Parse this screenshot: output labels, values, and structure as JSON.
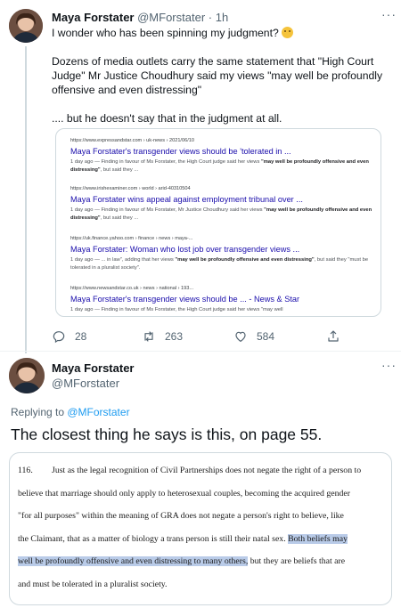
{
  "tweet1": {
    "name": "Maya Forstater",
    "handle": "@MForstater",
    "time": "1h",
    "line1": "I wonder who has been spinning my judgment?",
    "para2": "Dozens of media outlets carry the same statement that \"High Court Judge\" Mr Justice Choudhury said my views \"may well be profoundly offensive and even distressing\"",
    "para3": ".... but he doesn't say that in the judgment at all.",
    "results": [
      {
        "url": "https://www.expressandstar.com › uk-news › 2021/06/10",
        "title": "Maya Forstater's transgender views should be 'tolerated in ...",
        "snippet_plain": "1 day ago — Finding in favour of Ms Forstater, the High Court judge said her views ",
        "snippet_bold": "\"may well be profoundly offensive and even distressing\"",
        "snippet_tail": ", but said they ..."
      },
      {
        "url": "https://www.irishexaminer.com › world › arid-40310504",
        "title": "Maya Forstater wins appeal against employment tribunal over ...",
        "snippet_plain": "1 day ago — Finding in favour of Ms Forstater, Mr Justice Choudhury said her views ",
        "snippet_bold": "\"may well be profoundly offensive and even distressing\"",
        "snippet_tail": ", but said they ..."
      },
      {
        "url": "https://uk.finance.yahoo.com › finance › news › maya-...",
        "title": "Maya Forstater: Woman who lost job over transgender views ...",
        "snippet_plain": "1 day ago — ... in law\", adding that her views ",
        "snippet_bold": "\"may well be profoundly offensive and even distressing\"",
        "snippet_tail": ", but said they \"must be tolerated in a pluralist society\"."
      },
      {
        "url": "https://www.newsandstar.co.uk › news › national › 193...",
        "title": "Maya Forstater's transgender views should be ... - News & Star",
        "snippet_plain": "1 day ago — Finding in favour of Ms Forstater, the High Court judge said her views \"may well",
        "snippet_bold": "",
        "snippet_tail": ""
      }
    ],
    "replies": "28",
    "retweets": "263",
    "likes": "584"
  },
  "tweet2": {
    "name": "Maya Forstater",
    "handle": "@MForstater",
    "replying_prefix": "Replying to ",
    "replying_to": "@MForstater",
    "text": "The closest thing he says is this, on page 55.",
    "doc": {
      "para_num": "116.",
      "line1": "Just as the legal recognition of Civil Partnerships does not negate the right of a person to",
      "line2": "believe that marriage should only apply to heterosexual couples, becoming the acquired gender",
      "line3": "\"for all purposes\" within the meaning of GRA does not negate a person's right to believe, like",
      "line4_plain": "the Claimant, that as a matter of biology a trans person is still their natal sex.  ",
      "line4_hl": "Both beliefs may",
      "line5_hl": "well be profoundly offensive and even distressing to many others,",
      "line5_plain": " but they are beliefs that are",
      "line6": "and must be tolerated in a pluralist society."
    }
  },
  "colors": {
    "link_blue": "#1d9bf0",
    "search_title": "#1a0dab",
    "highlight": "#b9cbe8",
    "muted": "#536471"
  },
  "icons": [
    "more-icon",
    "reply-icon",
    "retweet-icon",
    "like-icon",
    "share-icon",
    "thinking-emoji"
  ]
}
